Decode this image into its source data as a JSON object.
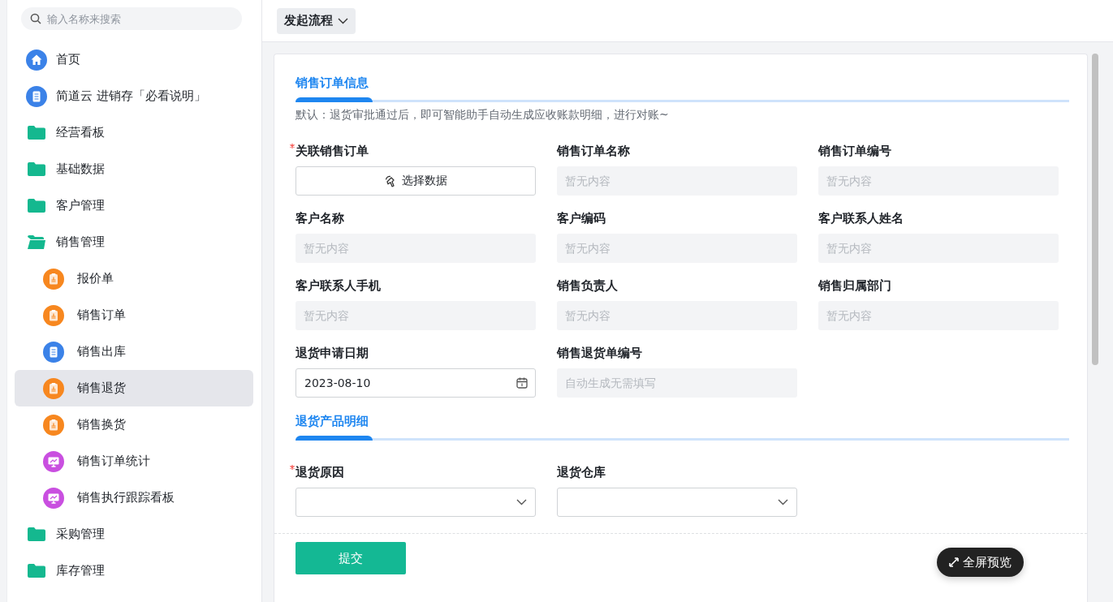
{
  "sidebar": {
    "search": {
      "placeholder": "输入名称来搜索"
    },
    "items": [
      {
        "label": "首页",
        "kind": "home",
        "color": "#3b82e8",
        "selected": false
      },
      {
        "label": "简道云 进销存「必看说明」",
        "kind": "doc",
        "color": "#3b82e8",
        "selected": false
      },
      {
        "label": "经营看板",
        "kind": "folder",
        "color": "#14b88f",
        "selected": false,
        "expanded": false
      },
      {
        "label": "基础数据",
        "kind": "folder",
        "color": "#14b88f",
        "selected": false,
        "expanded": false
      },
      {
        "label": "客户管理",
        "kind": "folder",
        "color": "#14b88f",
        "selected": false,
        "expanded": false
      },
      {
        "label": "销售管理",
        "kind": "folder",
        "color": "#14b88f",
        "selected": false,
        "expanded": true,
        "children": [
          {
            "label": "报价单",
            "kind": "form",
            "color": "#f7871f",
            "selected": false
          },
          {
            "label": "销售订单",
            "kind": "form",
            "color": "#f7871f",
            "selected": false
          },
          {
            "label": "销售出库",
            "kind": "doc",
            "color": "#3b82e8",
            "selected": false
          },
          {
            "label": "销售退货",
            "kind": "form",
            "color": "#f7871f",
            "selected": true
          },
          {
            "label": "销售换货",
            "kind": "form",
            "color": "#f7871f",
            "selected": false
          },
          {
            "label": "销售订单统计",
            "kind": "monitor",
            "color": "#c94fe0",
            "selected": false
          },
          {
            "label": "销售执行跟踪看板",
            "kind": "monitor",
            "color": "#c94fe0",
            "selected": false
          }
        ]
      },
      {
        "label": "采购管理",
        "kind": "folder",
        "color": "#14b88f",
        "selected": false,
        "expanded": false
      },
      {
        "label": "库存管理",
        "kind": "folder",
        "color": "#14b88f",
        "selected": false,
        "expanded": false
      }
    ]
  },
  "toolbar": {
    "menu_button": "发起流程"
  },
  "form": {
    "sections": [
      {
        "title": "销售订单信息",
        "description": "默认：退货审批通过后，即可智能助手自动生成应收账款明细，进行对账~",
        "fields": [
          {
            "label": "关联销售订单",
            "required": true,
            "kind": "select-data",
            "button": "选择数据"
          },
          {
            "label": "销售订单名称",
            "required": false,
            "kind": "readonly",
            "placeholder": "暂无内容"
          },
          {
            "label": "销售订单编号",
            "required": false,
            "kind": "readonly",
            "placeholder": "暂无内容"
          },
          {
            "label": "客户名称",
            "required": false,
            "kind": "readonly",
            "placeholder": "暂无内容"
          },
          {
            "label": "客户编码",
            "required": false,
            "kind": "readonly",
            "placeholder": "暂无内容"
          },
          {
            "label": "客户联系人姓名",
            "required": false,
            "kind": "readonly",
            "placeholder": "暂无内容"
          },
          {
            "label": "客户联系人手机",
            "required": false,
            "kind": "readonly",
            "placeholder": "暂无内容"
          },
          {
            "label": "销售负责人",
            "required": false,
            "kind": "readonly",
            "placeholder": "暂无内容"
          },
          {
            "label": "销售归属部门",
            "required": false,
            "kind": "readonly",
            "placeholder": "暂无内容"
          },
          {
            "label": "退货申请日期",
            "required": false,
            "kind": "date",
            "value": "2023-08-10"
          },
          {
            "label": "销售退货单编号",
            "required": false,
            "kind": "readonly",
            "placeholder": "自动生成无需填写"
          }
        ]
      },
      {
        "title": "退货产品明细",
        "fields": [
          {
            "label": "退货原因",
            "required": true,
            "kind": "dropdown"
          },
          {
            "label": "退货仓库",
            "required": false,
            "kind": "dropdown"
          }
        ]
      }
    ],
    "submit_button": "提交"
  },
  "fullscreen_button": "全屏预览"
}
